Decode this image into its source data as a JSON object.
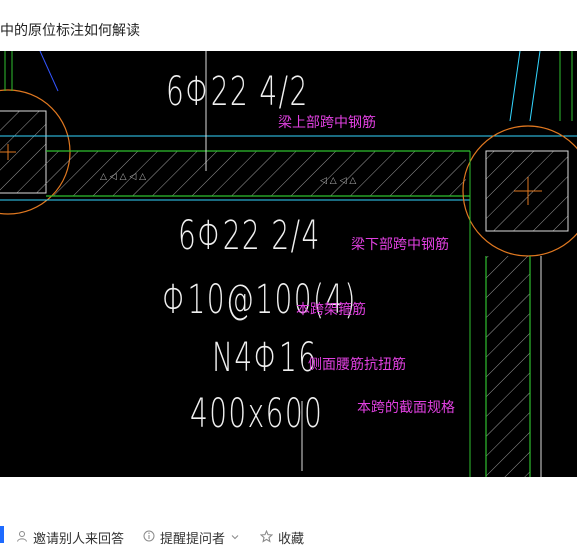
{
  "page": {
    "title": "中的原位标注如何解读"
  },
  "drawing": {
    "texts": {
      "top_rebar": "6Φ22 4/2",
      "bottom_rebar": "6Φ22 2/4",
      "stirrup": "Φ10@100(4)",
      "side_rebar": "N4Φ16",
      "section": "400x600"
    },
    "annotations": {
      "top": "梁上部跨中钢筋",
      "bottom": "梁下部跨中钢筋",
      "stirrup": "本跨架箍筋",
      "side": "侧面腰筋抗扭筋",
      "section": "本跨的截面规格"
    },
    "colors": {
      "background": "#000000",
      "beam_line": "#2fbf2f",
      "cyan_line": "#33d6ff",
      "column_circle": "#e07820",
      "annotation": "#e040e0"
    }
  },
  "actions": {
    "invite": "邀请别人来回答",
    "remind": "提醒提问者",
    "favorite": "收藏"
  }
}
